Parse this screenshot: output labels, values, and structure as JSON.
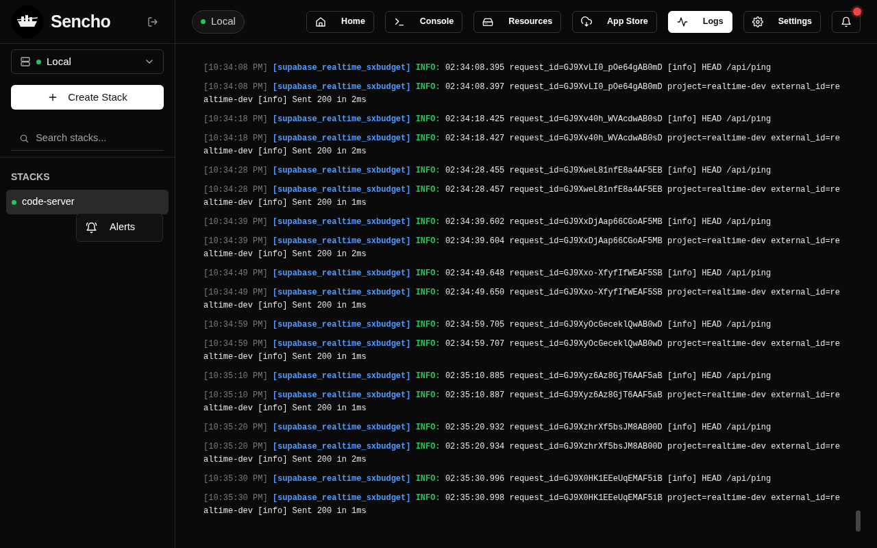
{
  "brand": {
    "name": "Sencho"
  },
  "sidebar": {
    "environment": {
      "label": "Local",
      "online": true
    },
    "create_button": "Create Stack",
    "search": {
      "placeholder": "Search stacks..."
    },
    "section_title": "STACKS",
    "stacks": [
      {
        "name": "code-server",
        "running": true,
        "selected": true
      }
    ],
    "context_menu": [
      {
        "label": "Alerts"
      }
    ]
  },
  "topbar": {
    "environment": {
      "label": "Local",
      "online": true
    },
    "nav": [
      {
        "label": "Home",
        "selected": false
      },
      {
        "label": "Console",
        "selected": false
      },
      {
        "label": "Resources",
        "selected": false
      },
      {
        "label": "App Store",
        "selected": false
      },
      {
        "label": "Logs",
        "selected": true
      },
      {
        "label": "Settings",
        "selected": false
      }
    ],
    "notifications": {
      "unread": true
    }
  },
  "logs": [
    {
      "time": "[10:34:08 PM]",
      "source": "[supabase_realtime_sxbudget]",
      "level": "INFO:",
      "message": "02:34:08.395 request_id=GJ9XvLI0_pOe64gAB0mD [info] HEAD /api/ping"
    },
    {
      "time": "[10:34:08 PM]",
      "source": "[supabase_realtime_sxbudget]",
      "level": "INFO:",
      "message": "02:34:08.397 request_id=GJ9XvLI0_pOe64gAB0mD project=realtime-dev external_id=realtime-dev [info] Sent 200 in 2ms"
    },
    {
      "time": "[10:34:18 PM]",
      "source": "[supabase_realtime_sxbudget]",
      "level": "INFO:",
      "message": "02:34:18.425 request_id=GJ9Xv40h_WVAcdwAB0sD [info] HEAD /api/ping"
    },
    {
      "time": "[10:34:18 PM]",
      "source": "[supabase_realtime_sxbudget]",
      "level": "INFO:",
      "message": "02:34:18.427 request_id=GJ9Xv40h_WVAcdwAB0sD project=realtime-dev external_id=realtime-dev [info] Sent 200 in 2ms"
    },
    {
      "time": "[10:34:28 PM]",
      "source": "[supabase_realtime_sxbudget]",
      "level": "INFO:",
      "message": "02:34:28.455 request_id=GJ9XweL81nfE8a4AF5EB [info] HEAD /api/ping"
    },
    {
      "time": "[10:34:28 PM]",
      "source": "[supabase_realtime_sxbudget]",
      "level": "INFO:",
      "message": "02:34:28.457 request_id=GJ9XweL81nfE8a4AF5EB project=realtime-dev external_id=realtime-dev [info] Sent 200 in 1ms"
    },
    {
      "time": "[10:34:39 PM]",
      "source": "[supabase_realtime_sxbudget]",
      "level": "INFO:",
      "message": "02:34:39.602 request_id=GJ9XxDjAap66CGoAF5MB [info] HEAD /api/ping"
    },
    {
      "time": "[10:34:39 PM]",
      "source": "[supabase_realtime_sxbudget]",
      "level": "INFO:",
      "message": "02:34:39.604 request_id=GJ9XxDjAap66CGoAF5MB project=realtime-dev external_id=realtime-dev [info] Sent 200 in 2ms"
    },
    {
      "time": "[10:34:49 PM]",
      "source": "[supabase_realtime_sxbudget]",
      "level": "INFO:",
      "message": "02:34:49.648 request_id=GJ9Xxo-XfyfIfWEAF5SB [info] HEAD /api/ping"
    },
    {
      "time": "[10:34:49 PM]",
      "source": "[supabase_realtime_sxbudget]",
      "level": "INFO:",
      "message": "02:34:49.650 request_id=GJ9Xxo-XfyfIfWEAF5SB project=realtime-dev external_id=realtime-dev [info] Sent 200 in 1ms"
    },
    {
      "time": "[10:34:59 PM]",
      "source": "[supabase_realtime_sxbudget]",
      "level": "INFO:",
      "message": "02:34:59.705 request_id=GJ9XyOcGeceklQwAB0wD [info] HEAD /api/ping"
    },
    {
      "time": "[10:34:59 PM]",
      "source": "[supabase_realtime_sxbudget]",
      "level": "INFO:",
      "message": "02:34:59.707 request_id=GJ9XyOcGeceklQwAB0wD project=realtime-dev external_id=realtime-dev [info] Sent 200 in 1ms"
    },
    {
      "time": "[10:35:10 PM]",
      "source": "[supabase_realtime_sxbudget]",
      "level": "INFO:",
      "message": "02:35:10.885 request_id=GJ9Xyz6Az8GjT6AAF5aB [info] HEAD /api/ping"
    },
    {
      "time": "[10:35:10 PM]",
      "source": "[supabase_realtime_sxbudget]",
      "level": "INFO:",
      "message": "02:35:10.887 request_id=GJ9Xyz6Az8GjT6AAF5aB project=realtime-dev external_id=realtime-dev [info] Sent 200 in 1ms"
    },
    {
      "time": "[10:35:20 PM]",
      "source": "[supabase_realtime_sxbudget]",
      "level": "INFO:",
      "message": "02:35:20.932 request_id=GJ9XzhrXf5bsJM8AB00D [info] HEAD /api/ping"
    },
    {
      "time": "[10:35:20 PM]",
      "source": "[supabase_realtime_sxbudget]",
      "level": "INFO:",
      "message": "02:35:20.934 request_id=GJ9XzhrXf5bsJM8AB00D project=realtime-dev external_id=realtime-dev [info] Sent 200 in 2ms"
    },
    {
      "time": "[10:35:30 PM]",
      "source": "[supabase_realtime_sxbudget]",
      "level": "INFO:",
      "message": "02:35:30.996 request_id=GJ9X0HK1EEeUqEMAF5iB [info] HEAD /api/ping"
    },
    {
      "time": "[10:35:30 PM]",
      "source": "[supabase_realtime_sxbudget]",
      "level": "INFO:",
      "message": "02:35:30.998 request_id=GJ9X0HK1EEeUqEMAF5iB project=realtime-dev external_id=realtime-dev [info] Sent 200 in 1ms"
    }
  ]
}
